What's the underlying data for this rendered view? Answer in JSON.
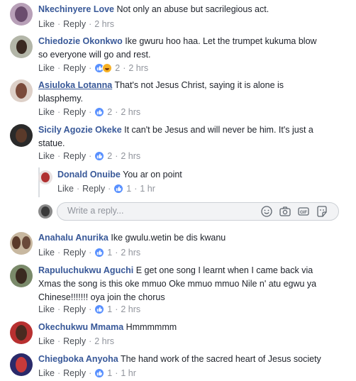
{
  "comments": [
    {
      "name": "Nkechinyere Love",
      "text": [
        "Not only an abuse but sacrilegious act."
      ],
      "like": "Like",
      "reply": "Reply",
      "reactions": null,
      "time": "2 hrs"
    },
    {
      "name": "Chiedozie Okonkwo",
      "text": [
        "Ike gwuru hoo haa. Let the trumpet kukuma blow",
        "so everyone will go and rest."
      ],
      "like": "Like",
      "reply": "Reply",
      "reactions": "2",
      "time": "2 hrs"
    },
    {
      "name": "Asiuloka Lotanna",
      "text": [
        "That's not Jesus Christ, saying it is alone is",
        "blasphemy."
      ],
      "like": "Like",
      "reply": "Reply",
      "reactions": "2",
      "time": "2 hrs"
    },
    {
      "name": "Sicily Agozie Okeke",
      "text": [
        "It can't be Jesus and will never be him. It's just a",
        "statue."
      ],
      "like": "Like",
      "reply": "Reply",
      "reactions": "2",
      "time": "2 hrs"
    },
    {
      "name": "Anahalu Anurika",
      "text": [
        "Ike gwulu.wetin be dis kwanu"
      ],
      "like": "Like",
      "reply": "Reply",
      "reactions": "1",
      "time": "2 hrs"
    },
    {
      "name": "Rapuluchukwu Aguchi",
      "text": [
        "E get one song I learnt when I came back via",
        "Xmas the song is this oke mmuo Oke mmuo mmuo Nile n' atu egwu ya",
        "Chinese!!!!!!! oya join the chorus"
      ],
      "like": "Like",
      "reply": "Reply",
      "reactions": "1",
      "time": "2 hrs"
    },
    {
      "name": "Okechukwu Mmama",
      "text": [
        "Hmmmmmm"
      ],
      "like": "Like",
      "reply": "Reply",
      "reactions": null,
      "time": "2 hrs"
    },
    {
      "name": "Chiegboka Anyoha",
      "text": [
        "The hand work of the sacred heart of Jesus society"
      ],
      "like": "Like",
      "reply": "Reply",
      "reactions": "1",
      "time": "1 hr"
    }
  ],
  "nested_reply": {
    "name": "Donald Onuibe",
    "text": "You ar on point",
    "like": "Like",
    "reply": "Reply",
    "reactions": "1",
    "time": "1 hr"
  },
  "composer": {
    "placeholder": "Write a reply...",
    "icons": [
      "emoji-icon",
      "camera-icon",
      "gif-icon",
      "sticker-icon"
    ]
  },
  "colors": {
    "name_link": "#385898",
    "meta": "#90949c",
    "like_badge": "#5890ff",
    "haha_badge": "#f7b125"
  }
}
